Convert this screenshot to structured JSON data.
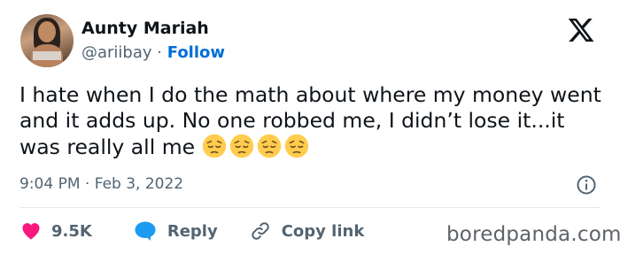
{
  "author": {
    "display_name": "Aunty Mariah",
    "handle": "@ariibay",
    "separator": "·",
    "follow_label": "Follow"
  },
  "tweet": {
    "text": "I hate when I do the math about where my money went and it adds up. No one robbed me, I didn’t lose it...it was really all me",
    "emoji": [
      "pensive-face",
      "pensive-face",
      "pensive-face",
      "pensive-face"
    ],
    "time": "9:04 PM",
    "date_separator": "·",
    "date": "Feb 3, 2022"
  },
  "actions": {
    "likes_count": "9.5K",
    "reply_label": "Reply",
    "copy_link_label": "Copy link"
  },
  "watermark": "boredpanda.com",
  "colors": {
    "like_heart": "#f91880",
    "reply_bubble": "#1d9bf0",
    "follow_link": "#006fd6",
    "secondary_text": "#536471",
    "emoji_face": "#ffcc4d"
  }
}
